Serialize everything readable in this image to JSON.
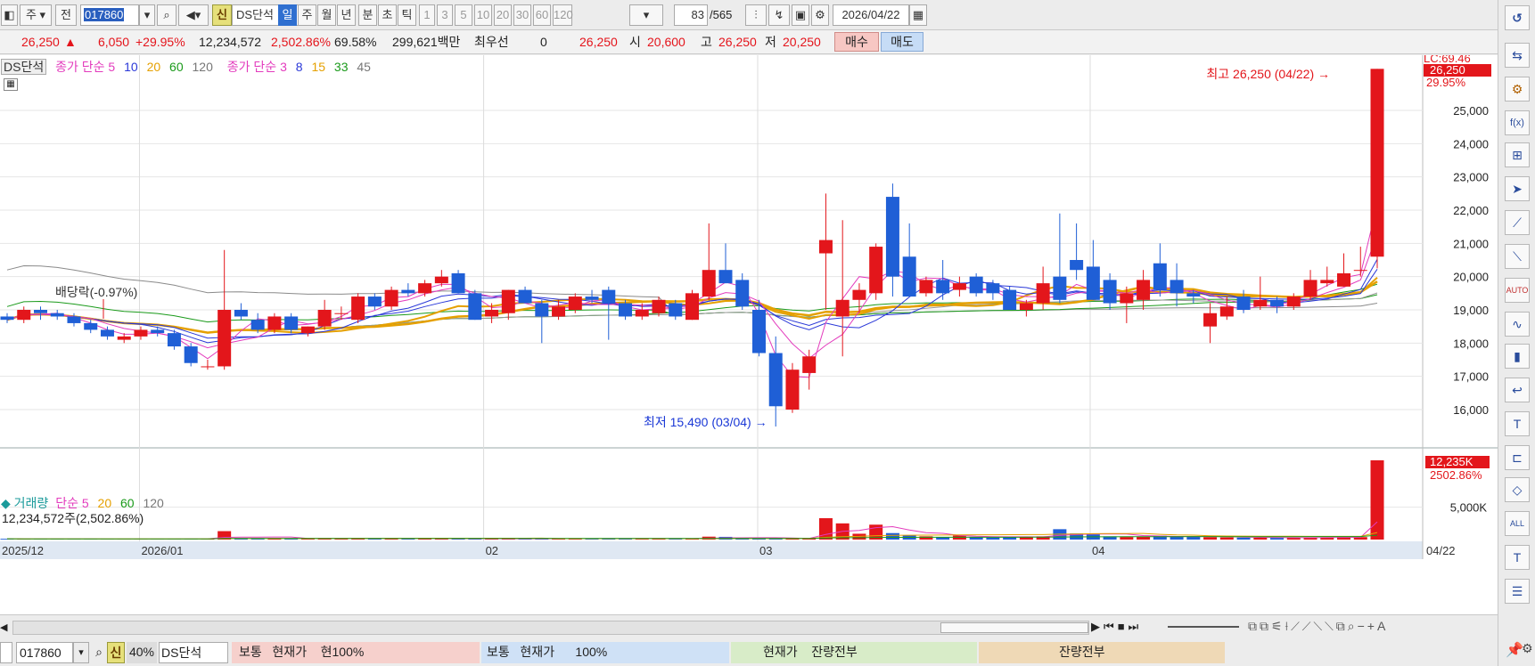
{
  "toolbar": {
    "type_label": "주",
    "prev_label": "전",
    "stock_code": "017860",
    "new_badge": "신",
    "stock_name": "DS단석",
    "periods": [
      "일",
      "주",
      "월",
      "년",
      "분",
      "초",
      "틱"
    ],
    "active_period": "일",
    "intervals": [
      "1",
      "3",
      "5",
      "10",
      "20",
      "30",
      "60",
      "120"
    ],
    "count_value": "83",
    "count_total": "/565",
    "date": "2026/04/22"
  },
  "quote": {
    "price": "26,250",
    "change": "6,050",
    "change_pct": "+29.95%",
    "volume": "12,234,572",
    "volume_ratio": "2,502.86%",
    "turnover": "69.58%",
    "amount": "299,621백만",
    "best_bid_label": "최우선",
    "best_bid": "0",
    "best_price": "26,250",
    "open_label": "시",
    "open": "20,600",
    "high_label": "고",
    "high": "26,250",
    "low_label": "저",
    "low": "20,250",
    "buy_label": "매수",
    "sell_label": "매도"
  },
  "price_legend": {
    "name_tag": "DS단석",
    "ma1_label": "종가 단순",
    "ma1_periods": [
      "5",
      "10",
      "20",
      "60",
      "120"
    ],
    "ma2_label": "종가 단순",
    "ma2_periods": [
      "3",
      "8",
      "15",
      "33",
      "45"
    ]
  },
  "annotations": {
    "high_text": "최고 26,250 (04/22)",
    "low_text": "최저 15,490 (03/04)",
    "dividend_text": "배당락(-0.97%)",
    "lc_text": "LC:69.46",
    "price_tag": "26,250",
    "pct_tag": "29.95%",
    "vol_tag": "12,235K",
    "vol_pct_tag": "2502.86%"
  },
  "volume_legend": {
    "label": "거래량",
    "ma_label": "단순",
    "periods": [
      "5",
      "20",
      "60",
      "120"
    ],
    "value_text": "12,234,572주(2,502.86%)"
  },
  "chart_data": {
    "type": "candlestick",
    "price_axis": {
      "ticks": [
        16000,
        17000,
        18000,
        19000,
        20000,
        21000,
        22000,
        23000,
        24000,
        25000
      ],
      "range": [
        15000,
        26800
      ]
    },
    "volume_axis": {
      "ticks": [
        "5,000K"
      ]
    },
    "date_labels": [
      "2025/12",
      "2026/01",
      "02",
      "03",
      "04",
      "04/22"
    ],
    "candles": [
      [
        18800,
        18900,
        18600,
        18700
      ],
      [
        18700,
        19100,
        18600,
        19000
      ],
      [
        19000,
        19100,
        18700,
        18900
      ],
      [
        18900,
        19000,
        18700,
        18800
      ],
      [
        18800,
        18900,
        18500,
        18600
      ],
      [
        18600,
        18700,
        18300,
        18400
      ],
      [
        18400,
        18500,
        18100,
        18200
      ],
      [
        18100,
        18300,
        18000,
        18200
      ],
      [
        18200,
        18500,
        18100,
        18400
      ],
      [
        18400,
        18500,
        18200,
        18300
      ],
      [
        18300,
        18400,
        17800,
        17900
      ],
      [
        17900,
        18000,
        17300,
        17400
      ],
      [
        17300,
        17500,
        17200,
        17300
      ],
      [
        17300,
        20800,
        17200,
        19000
      ],
      [
        19000,
        19200,
        18700,
        18800
      ],
      [
        18700,
        18900,
        18300,
        18400
      ],
      [
        18400,
        18900,
        18300,
        18800
      ],
      [
        18800,
        18900,
        18300,
        18400
      ],
      [
        18300,
        18500,
        18200,
        18500
      ],
      [
        18500,
        19300,
        18400,
        19000
      ],
      [
        18900,
        19100,
        18700,
        18900
      ],
      [
        18700,
        19500,
        18600,
        19400
      ],
      [
        19400,
        19500,
        19000,
        19100
      ],
      [
        19100,
        19700,
        19000,
        19600
      ],
      [
        19600,
        19800,
        19400,
        19500
      ],
      [
        19500,
        19900,
        19400,
        19800
      ],
      [
        19800,
        20200,
        19700,
        20000
      ],
      [
        20100,
        20200,
        19500,
        19500
      ],
      [
        19500,
        19600,
        18700,
        18700
      ],
      [
        18800,
        19200,
        18600,
        19000
      ],
      [
        18900,
        19600,
        18700,
        19600
      ],
      [
        19600,
        19700,
        19200,
        19200
      ],
      [
        19200,
        19300,
        18000,
        18800
      ],
      [
        18800,
        19300,
        18700,
        19100
      ],
      [
        19000,
        19500,
        18900,
        19400
      ],
      [
        19400,
        19600,
        19200,
        19300
      ],
      [
        19600,
        19700,
        18100,
        19200
      ],
      [
        19200,
        19300,
        18700,
        18800
      ],
      [
        18800,
        19200,
        18700,
        19000
      ],
      [
        18900,
        19400,
        18800,
        19300
      ],
      [
        19200,
        19300,
        18700,
        18800
      ],
      [
        18700,
        19600,
        18700,
        19500
      ],
      [
        19400,
        21600,
        19300,
        20200
      ],
      [
        20200,
        21000,
        19800,
        19800
      ],
      [
        19900,
        20100,
        19000,
        19100
      ],
      [
        19000,
        19300,
        17600,
        17700
      ],
      [
        17700,
        18200,
        15490,
        16100
      ],
      [
        16000,
        17400,
        15900,
        17200
      ],
      [
        17100,
        17800,
        16600,
        17600
      ],
      [
        20700,
        22500,
        19000,
        21100
      ],
      [
        18800,
        21700,
        17600,
        19300
      ],
      [
        19300,
        19800,
        18900,
        19600
      ],
      [
        19500,
        21000,
        19300,
        20900
      ],
      [
        22400,
        22800,
        19400,
        20000
      ],
      [
        20600,
        21600,
        19400,
        19400
      ],
      [
        19500,
        20000,
        19400,
        19900
      ],
      [
        19900,
        20500,
        19300,
        19500
      ],
      [
        19600,
        20000,
        19400,
        19800
      ],
      [
        20000,
        20100,
        19400,
        19500
      ],
      [
        19800,
        19900,
        19300,
        19500
      ],
      [
        19600,
        19700,
        19000,
        19000
      ],
      [
        19000,
        19300,
        18800,
        19200
      ],
      [
        19200,
        20300,
        19000,
        19800
      ],
      [
        20000,
        21900,
        19200,
        19300
      ],
      [
        20500,
        21600,
        19900,
        20200
      ],
      [
        20300,
        21100,
        19300,
        19300
      ],
      [
        19900,
        20100,
        19000,
        19200
      ],
      [
        19200,
        19700,
        18600,
        19500
      ],
      [
        19300,
        20200,
        19000,
        19900
      ],
      [
        20400,
        21000,
        19400,
        19600
      ],
      [
        19900,
        20400,
        19100,
        19500
      ],
      [
        19500,
        19600,
        19200,
        19400
      ],
      [
        18500,
        19200,
        18000,
        18900
      ],
      [
        18800,
        19400,
        18700,
        19100
      ],
      [
        19400,
        19600,
        18900,
        19000
      ],
      [
        19100,
        20000,
        19000,
        19300
      ],
      [
        19300,
        19400,
        18900,
        19100
      ],
      [
        19100,
        19500,
        19000,
        19400
      ],
      [
        19400,
        20200,
        19300,
        19900
      ],
      [
        19800,
        20300,
        19700,
        19900
      ],
      [
        19700,
        20700,
        19700,
        20100
      ],
      [
        20200,
        20900,
        20000,
        20200
      ],
      [
        20600,
        26250,
        20250,
        26250
      ]
    ],
    "volumes_k": [
      120,
      100,
      90,
      80,
      100,
      90,
      80,
      70,
      90,
      80,
      110,
      120,
      100,
      1300,
      220,
      160,
      200,
      140,
      120,
      220,
      160,
      200,
      150,
      170,
      140,
      160,
      170,
      120,
      110,
      100,
      150,
      120,
      160,
      130,
      140,
      150,
      180,
      140,
      120,
      150,
      140,
      160,
      450,
      420,
      200,
      180,
      210,
      150,
      180,
      3300,
      2500,
      900,
      2300,
      1000,
      650,
      500,
      380,
      620,
      420,
      320,
      400,
      390,
      500,
      1600,
      950,
      800,
      500,
      400,
      450,
      600,
      480,
      420,
      380,
      330,
      300,
      280,
      260,
      300,
      320,
      350,
      400,
      380,
      12235
    ]
  }
}
